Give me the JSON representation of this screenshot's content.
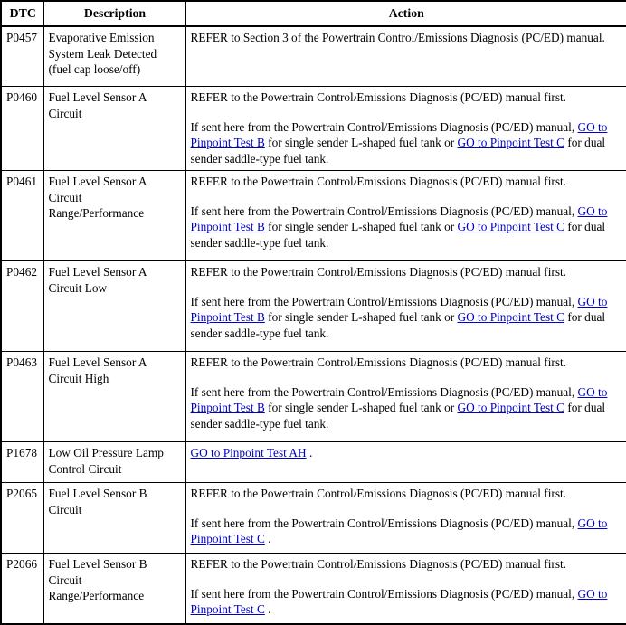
{
  "table": {
    "headers": {
      "dtc": "DTC",
      "description": "Description",
      "action": "Action"
    },
    "rows": [
      {
        "dtc": "P0457",
        "description_lines": [
          "Evaporative Emission",
          "System Leak Detected",
          "(fuel cap loose/off)"
        ],
        "action_paragraphs": [
          {
            "segments": [
              {
                "type": "text",
                "text": "REFER to Section 3 of the Powertrain Control/Emissions Diagnosis (PC/ED) manual."
              }
            ]
          }
        ]
      },
      {
        "dtc": "P0460",
        "description_lines": [
          "Fuel Level Sensor A",
          "Circuit"
        ],
        "action_paragraphs": [
          {
            "segments": [
              {
                "type": "text",
                "text": "REFER to the Powertrain Control/Emissions Diagnosis (PC/ED) manual first."
              }
            ]
          },
          {
            "segments": [
              {
                "type": "text",
                "text": "If sent here from the Powertrain Control/Emissions Diagnosis (PC/ED) manual, "
              },
              {
                "type": "link",
                "text": "GO to Pinpoint Test B"
              },
              {
                "type": "text",
                "text": " for single sender L-shaped fuel tank or "
              },
              {
                "type": "link",
                "text": "GO to Pinpoint Test C"
              },
              {
                "type": "text",
                "text": " for dual sender saddle-type fuel tank."
              }
            ]
          }
        ]
      },
      {
        "dtc": "P0461",
        "description_lines": [
          "Fuel Level Sensor A",
          "Circuit",
          "Range/Performance"
        ],
        "action_paragraphs": [
          {
            "segments": [
              {
                "type": "text",
                "text": "REFER to the Powertrain Control/Emissions Diagnosis (PC/ED) manual first."
              }
            ]
          },
          {
            "segments": [
              {
                "type": "text",
                "text": "If sent here from the Powertrain Control/Emissions Diagnosis (PC/ED) manual, "
              },
              {
                "type": "link",
                "text": "GO to Pinpoint Test B"
              },
              {
                "type": "text",
                "text": " for single sender L-shaped fuel tank or "
              },
              {
                "type": "link",
                "text": "GO to Pinpoint Test C"
              },
              {
                "type": "text",
                "text": " for dual sender saddle-type fuel tank."
              }
            ]
          }
        ]
      },
      {
        "dtc": "P0462",
        "description_lines": [
          "Fuel Level Sensor A",
          "Circuit Low"
        ],
        "action_paragraphs": [
          {
            "segments": [
              {
                "type": "text",
                "text": "REFER to the Powertrain Control/Emissions Diagnosis (PC/ED) manual first."
              }
            ]
          },
          {
            "segments": [
              {
                "type": "text",
                "text": "If sent here from the Powertrain Control/Emissions Diagnosis (PC/ED) manual, "
              },
              {
                "type": "link",
                "text": "GO to Pinpoint Test B"
              },
              {
                "type": "text",
                "text": " for single sender L-shaped fuel tank or "
              },
              {
                "type": "link",
                "text": "GO to Pinpoint Test C"
              },
              {
                "type": "text",
                "text": " for dual sender saddle-type fuel tank."
              }
            ]
          }
        ]
      },
      {
        "dtc": "P0463",
        "description_lines": [
          "Fuel Level Sensor A",
          "Circuit High"
        ],
        "action_paragraphs": [
          {
            "segments": [
              {
                "type": "text",
                "text": "REFER to the Powertrain Control/Emissions Diagnosis (PC/ED) manual first."
              }
            ]
          },
          {
            "segments": [
              {
                "type": "text",
                "text": "If sent here from the Powertrain Control/Emissions Diagnosis (PC/ED) manual, "
              },
              {
                "type": "link",
                "text": "GO to Pinpoint Test B"
              },
              {
                "type": "text",
                "text": " for single sender L-shaped fuel tank or "
              },
              {
                "type": "link",
                "text": "GO to Pinpoint Test C"
              },
              {
                "type": "text",
                "text": " for dual sender saddle-type fuel tank."
              }
            ]
          }
        ]
      },
      {
        "dtc": "P1678",
        "description_lines": [
          "Low Oil Pressure Lamp",
          "Control Circuit"
        ],
        "action_paragraphs": [
          {
            "segments": [
              {
                "type": "link",
                "text": "GO to Pinpoint Test AH"
              },
              {
                "type": "text",
                "text": " ."
              }
            ]
          }
        ]
      },
      {
        "dtc": "P2065",
        "description_lines": [
          "Fuel Level Sensor B",
          "Circuit"
        ],
        "action_paragraphs": [
          {
            "segments": [
              {
                "type": "text",
                "text": "REFER to the Powertrain Control/Emissions Diagnosis (PC/ED) manual first."
              }
            ]
          },
          {
            "segments": [
              {
                "type": "text",
                "text": "If sent here from the Powertrain Control/Emissions Diagnosis (PC/ED) manual, "
              },
              {
                "type": "link",
                "text": "GO to Pinpoint Test C"
              },
              {
                "type": "text",
                "text": " ."
              }
            ]
          }
        ]
      },
      {
        "dtc": "P2066",
        "description_lines": [
          "Fuel Level Sensor B",
          "Circuit",
          "Range/Performance"
        ],
        "action_paragraphs": [
          {
            "segments": [
              {
                "type": "text",
                "text": "REFER to the Powertrain Control/Emissions Diagnosis (PC/ED) manual first."
              }
            ]
          },
          {
            "segments": [
              {
                "type": "text",
                "text": "If sent here from the Powertrain Control/Emissions Diagnosis (PC/ED) manual, "
              },
              {
                "type": "link",
                "text": "GO to Pinpoint Test C"
              },
              {
                "type": "text",
                "text": " ."
              }
            ]
          }
        ]
      }
    ]
  },
  "colors": {
    "link": "#0000cc",
    "border": "#000000",
    "text": "#000000",
    "background": "#ffffff"
  }
}
